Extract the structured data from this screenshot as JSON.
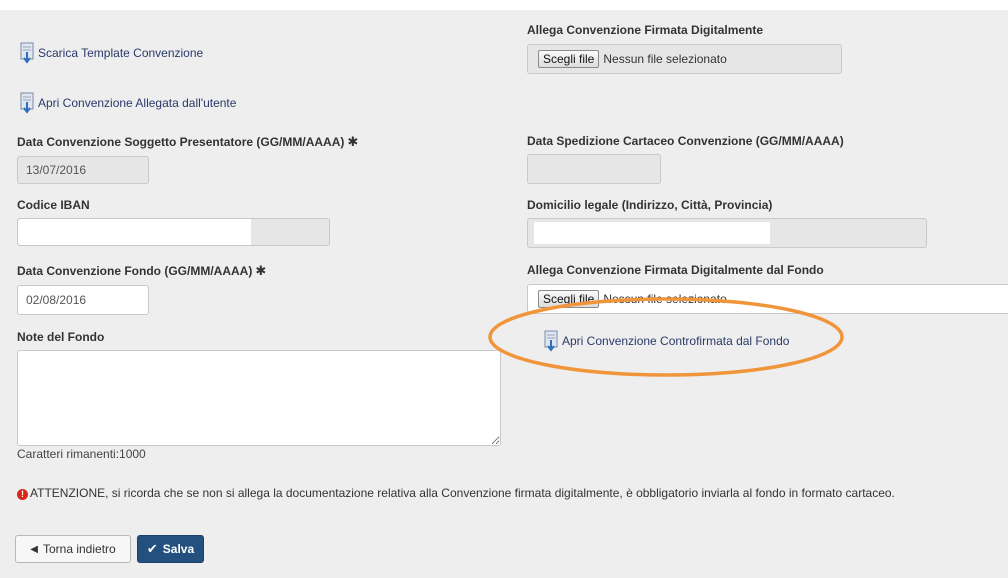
{
  "left": {
    "template_link": "Scarica Template Convenzione",
    "user_attached_link": "Apri Convenzione Allegata dall'utente",
    "data_soggetto": {
      "label": "Data Convenzione Soggetto Presentatore (GG/MM/AAAA)",
      "required_mark": "✱",
      "value": "13/07/2016"
    },
    "iban": {
      "label": "Codice IBAN",
      "value": ""
    },
    "data_fondo": {
      "label": "Data Convenzione Fondo (GG/MM/AAAA)",
      "required_mark": "✱",
      "value": "02/08/2016"
    },
    "note": {
      "label": "Note del Fondo",
      "value": "",
      "counter": "Caratteri rimanenti:1000"
    }
  },
  "right": {
    "allega_firmata": {
      "label": "Allega Convenzione Firmata Digitalmente",
      "button": "Scegli file",
      "status": "Nessun file selezionato"
    },
    "data_spedizione": {
      "label": "Data Spedizione Cartaceo Convenzione (GG/MM/AAAA)",
      "value": ""
    },
    "domicilio": {
      "label": "Domicilio legale (Indirizzo, Città, Provincia)",
      "value": ""
    },
    "allega_fondo": {
      "label": "Allega Convenzione Firmata Digitalmente dal Fondo",
      "button": "Scegli file",
      "status": "Nessun file selezionato"
    },
    "controfirmata_link": "Apri Convenzione Controfirmata dal Fondo"
  },
  "warning": {
    "icon": "exclamation-circle-icon",
    "text": "ATTENZIONE, si ricorda che se non si allega la documentazione relativa alla Convenzione firmata digitalmente, è obbligatorio inviarla al fondo in formato cartaceo."
  },
  "buttons": {
    "back": "Torna indietro",
    "save": "Salva"
  },
  "colors": {
    "panel": "#eeeeee",
    "save_button": "#24507f",
    "highlight_ellipse": "#f0953a",
    "warning_icon": "#d9261c"
  }
}
